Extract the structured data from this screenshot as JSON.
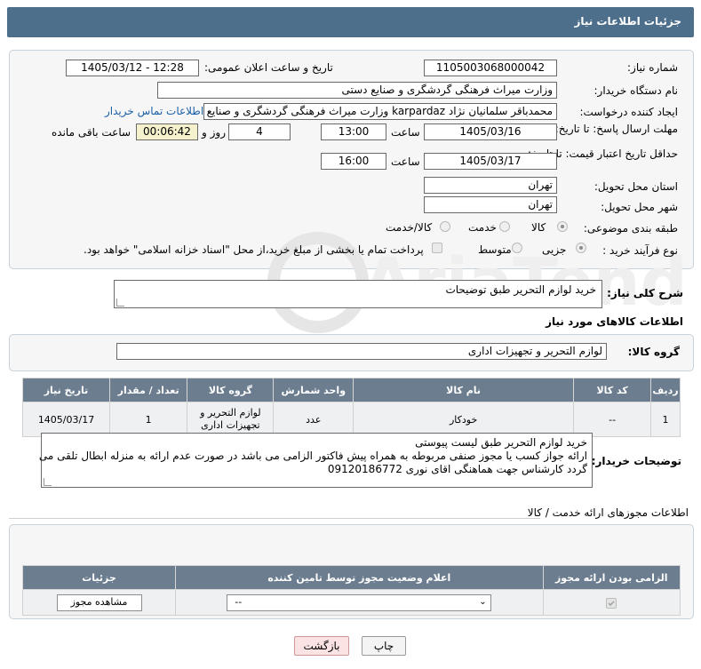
{
  "title": "جزئیات اطلاعات نیاز",
  "form": {
    "need_number_label": "شماره نیاز:",
    "need_number": "1105003068000042",
    "announce_label": "تاریخ و ساعت اعلان عمومی:",
    "announce_value": "1405/03/12 - 12:28",
    "buyer_org_label": "نام دستگاه خریدار:",
    "buyer_org": "وزارت میراث فرهنگی  گردشگری و صنایع دستی",
    "creator_label": "ایجاد کننده درخواست:",
    "creator": "محمدباقر سلمانیان نژاد karpardaz وزارت میراث فرهنگی  گردشگری و صنایع دس",
    "contact_link": "اطلاعات تماس خریدار",
    "deadline_label": "مهلت ارسال پاسخ: تا تاریخ:",
    "deadline_date": "1405/03/16",
    "time_word": "ساعت",
    "deadline_time": "13:00",
    "days_value": "4",
    "days_and": "روز و",
    "remaining_time": "00:06:42",
    "remaining_label": "ساعت باقی مانده",
    "validity_label": "حداقل تاریخ اعتبار قیمت: تا تاریخ:",
    "validity_date": "1405/03/17",
    "validity_time": "16:00",
    "province_label": "استان محل تحویل:",
    "province": "تهران",
    "city_label": "شهر محل تحویل:",
    "city": "تهران",
    "category_label": "طبقه بندی موضوعی:",
    "category_options": [
      "کالا",
      "خدمت",
      "کالا/خدمت"
    ],
    "process_label": "نوع فرآیند خرید :",
    "process_options": [
      "جزیی",
      "متوسط"
    ],
    "payment_note": "پرداخت تمام یا بخشی از مبلغ خرید،از محل \"اسناد خزانه اسلامی\" خواهد بود."
  },
  "summary": {
    "label": "شرح کلی نیاز:",
    "value": "خرید لوازم التحریر طبق توضیحات"
  },
  "goods": {
    "section_title": "اطلاعات کالاهای مورد نیاز",
    "group_label": "گروه کالا:",
    "group_value": "لوازم التحریر و تجهیزات اداری",
    "headers": [
      "ردیف",
      "کد کالا",
      "نام کالا",
      "واحد شمارش",
      "گروه کالا",
      "تعداد / مقدار",
      "تاریخ نیاز"
    ],
    "rows": [
      {
        "row": "1",
        "code": "--",
        "name": "خودکار",
        "unit": "عدد",
        "group": "لوازم التحریر و تجهیزات اداری",
        "qty": "1",
        "date": "1405/03/17"
      }
    ]
  },
  "buyer_notes": {
    "label": "توضیحات خریدار:",
    "line1": "خرید لوازم التحریر طبق لیست پیوستی",
    "line2": "ارائه جواز کسب یا مجوز صنفی مربوطه به همراه پیش فاکتور الزامی می باشد در صورت عدم ارائه به منزله ابطال تلقی می",
    "line3": "گردد  کارشناس جهت هماهنگی اقای نوری 09120186772"
  },
  "permits": {
    "section_title": "اطلاعات مجوزهای ارائه خدمت / کالا",
    "headers": [
      "الزامی بودن ارائه مجوز",
      "اعلام وضعیت مجوز توسط تامین کننده",
      "جزئیات"
    ],
    "select_value": "--",
    "view_button": "مشاهده مجوز"
  },
  "buttons": {
    "print": "چاپ",
    "back": "بازگشت"
  },
  "watermark": "AriaTender.net",
  "colors": {
    "header_bar": "#4d6f8c",
    "table_header": "#6b7d8f",
    "link": "#1a5fa8",
    "highlight": "#f5f1cc",
    "back_button": "#fbe3e3"
  }
}
